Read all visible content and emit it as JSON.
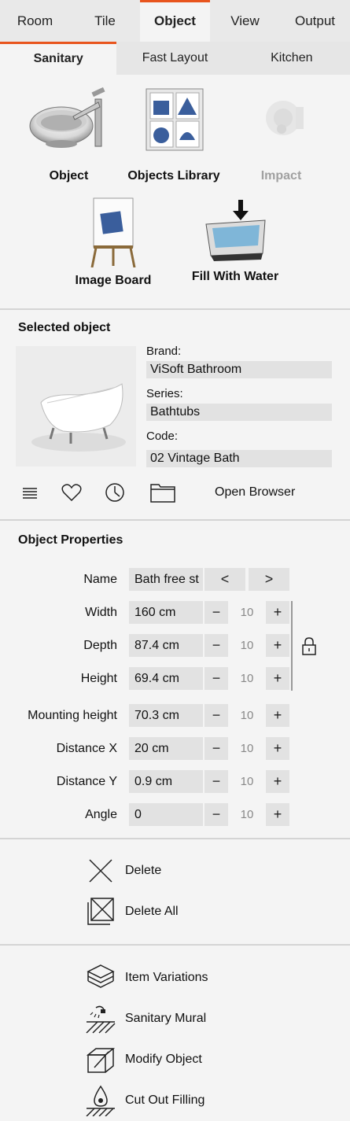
{
  "main_tabs": [
    "Room",
    "Tile",
    "Object",
    "View",
    "Output"
  ],
  "sub_tabs": [
    "Sanitary",
    "Fast Layout",
    "Kitchen"
  ],
  "ribbon": {
    "object": "Object",
    "objects_library": "Objects Library",
    "impact": "Impact",
    "image_board": "Image Board",
    "fill_with_water": "Fill With Water"
  },
  "selected_object": {
    "title": "Selected object",
    "brand_label": "Brand:",
    "brand": "ViSoft Bathroom",
    "series_label": "Series:",
    "series": "Bathtubs",
    "code_label": "Code:",
    "code": "02 Vintage Bath",
    "open_browser": "Open Browser"
  },
  "properties": {
    "title": "Object Properties",
    "name_label": "Name",
    "name_value": "Bath free st",
    "prev": "<",
    "next": ">",
    "minus": "−",
    "plus": "+",
    "rows": [
      {
        "label": "Width",
        "value": "160 cm",
        "step": "10"
      },
      {
        "label": "Depth",
        "value": "87.4 cm",
        "step": "10"
      },
      {
        "label": "Height",
        "value": "69.4 cm",
        "step": "10"
      },
      {
        "label": "Mounting height",
        "value": "70.3 cm",
        "step": "10"
      },
      {
        "label": "Distance X",
        "value": "20 cm",
        "step": "10"
      },
      {
        "label": "Distance Y",
        "value": "0.9 cm",
        "step": "10"
      },
      {
        "label": "Angle",
        "value": "0",
        "step": "10"
      }
    ]
  },
  "actions": {
    "delete": "Delete",
    "delete_all": "Delete All",
    "item_variations": "Item Variations",
    "sanitary_mural": "Sanitary Mural",
    "modify_object": "Modify Object",
    "cut_out_filling": "Cut Out Filling"
  },
  "colors": {
    "accent": "#e8551e",
    "field_bg": "#e2e2e2",
    "panel_bg": "#f4f4f4"
  }
}
